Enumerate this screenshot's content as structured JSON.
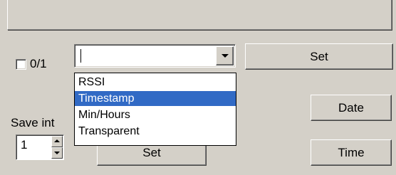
{
  "options_toggle": {
    "label": "0/1",
    "checked": false
  },
  "combo": {
    "value": "",
    "open": true,
    "options": [
      "RSSI",
      "Timestamp",
      "Min/Hours",
      "Transparent"
    ],
    "highlighted_option": "Timestamp",
    "highlight_color": "#316ac5"
  },
  "buttons": {
    "set_top": "Set",
    "date": "Date",
    "time": "Time",
    "set_bottom": "Set"
  },
  "save_interval": {
    "label": "Save int",
    "value": "1"
  },
  "colors": {
    "window_background": "#d4d0c8"
  },
  "icons": {
    "combo_arrow": "chevron-down-icon",
    "spin_up": "chevron-up-icon",
    "spin_down": "chevron-down-icon"
  }
}
